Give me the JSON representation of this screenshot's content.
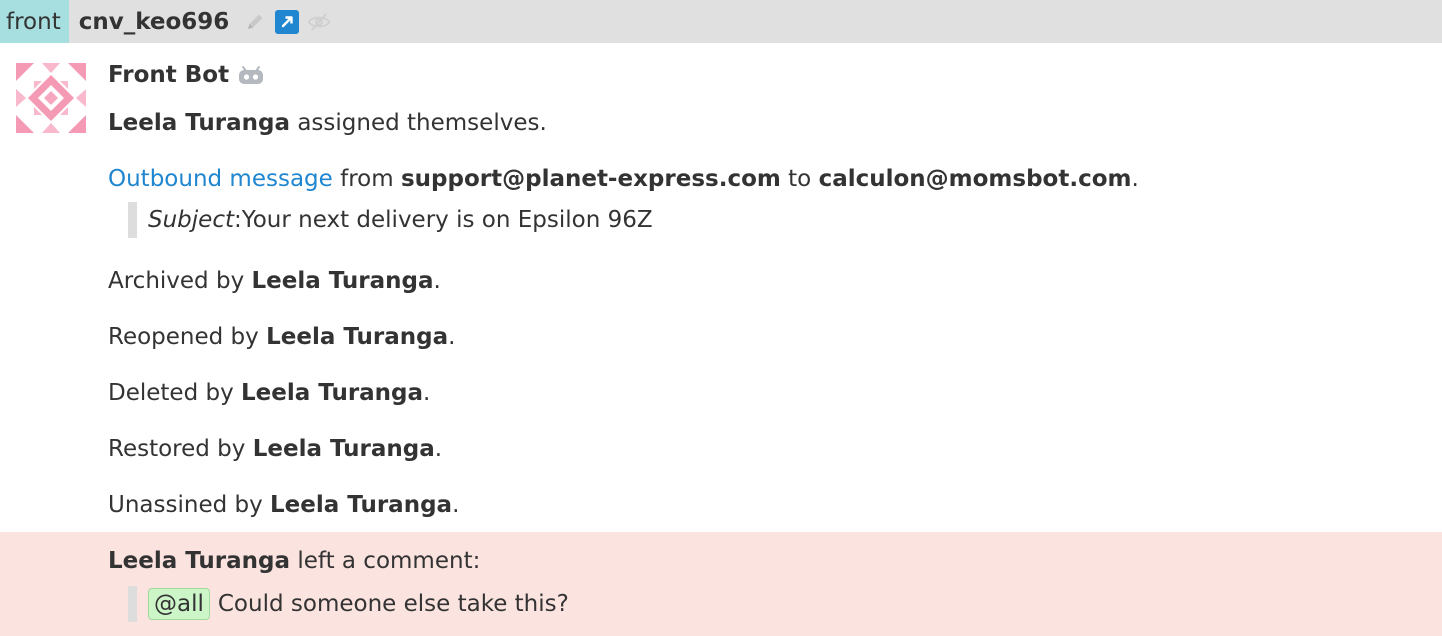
{
  "header": {
    "stream": "front",
    "topic": "cnv_keo696",
    "icons": [
      "pencil-icon",
      "external-link-icon",
      "eye-slash-icon"
    ]
  },
  "message": {
    "sender": "Front Bot",
    "sender_icon": "bot-icon",
    "assigned": {
      "actor": "Leela Turanga",
      "text": " assigned themselves."
    },
    "outbound": {
      "link_text": "Outbound message",
      "from_text": " from ",
      "from": "support@planet-express.com",
      "to_text": " to ",
      "to": "calculon@momsbot.com",
      "end": ".",
      "subject_label": "Subject",
      "subject_sep": ": ",
      "subject": "Your next delivery is on Epsilon 96Z"
    },
    "events": [
      {
        "prefix": "Archived by ",
        "actor": "Leela Turanga",
        "end": "."
      },
      {
        "prefix": "Reopened by ",
        "actor": "Leela Turanga",
        "end": "."
      },
      {
        "prefix": "Deleted by ",
        "actor": "Leela Turanga",
        "end": "."
      },
      {
        "prefix": "Restored by ",
        "actor": "Leela Turanga",
        "end": "."
      },
      {
        "prefix": "Unassined by ",
        "actor": "Leela Turanga",
        "end": "."
      }
    ],
    "comment": {
      "actor": "Leela Turanga",
      "text": " left a comment:",
      "mention": "@all",
      "body": "Could someone else take this?"
    }
  },
  "colors": {
    "stream_bg": "#a7dfe0",
    "header_bg": "#e0e0e0",
    "link": "#1f86cf",
    "comment_bg": "#fbe3df",
    "mention_bg": "#ccf5c8",
    "avatar_pink": "#f59ab5"
  }
}
